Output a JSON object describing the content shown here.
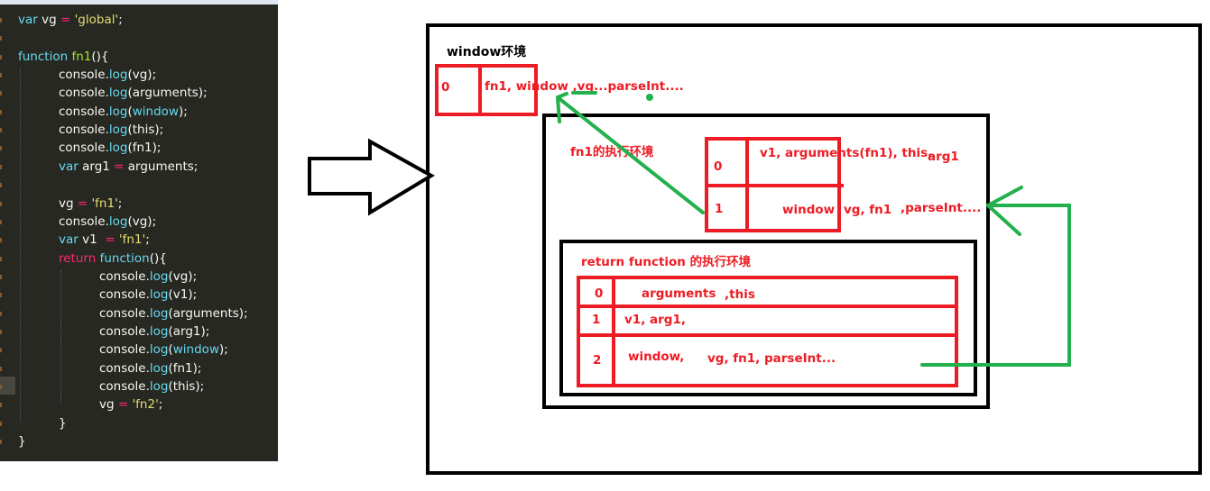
{
  "editor": {
    "lines": [
      {
        "indent": 0,
        "tokens": [
          {
            "t": "var",
            "c": "k"
          },
          {
            "t": " vg ",
            "c": "p"
          },
          {
            "t": "=",
            "c": "o"
          },
          {
            "t": " ",
            "c": "p"
          },
          {
            "t": "'global'",
            "c": "s"
          },
          {
            "t": ";",
            "c": "p"
          }
        ]
      },
      {
        "indent": 0,
        "tokens": []
      },
      {
        "indent": 0,
        "tokens": [
          {
            "t": "function",
            "c": "k"
          },
          {
            "t": " ",
            "c": "p"
          },
          {
            "t": "fn1",
            "c": "f"
          },
          {
            "t": "(){",
            "c": "p"
          }
        ]
      },
      {
        "indent": 1,
        "tokens": [
          {
            "t": "console.",
            "c": "p"
          },
          {
            "t": "log",
            "c": "k"
          },
          {
            "t": "(vg);",
            "c": "p"
          }
        ]
      },
      {
        "indent": 1,
        "tokens": [
          {
            "t": "console.",
            "c": "p"
          },
          {
            "t": "log",
            "c": "k"
          },
          {
            "t": "(arguments);",
            "c": "p"
          }
        ]
      },
      {
        "indent": 1,
        "tokens": [
          {
            "t": "console.",
            "c": "p"
          },
          {
            "t": "log",
            "c": "k"
          },
          {
            "t": "(",
            "c": "p"
          },
          {
            "t": "window",
            "c": "k"
          },
          {
            "t": ");",
            "c": "p"
          }
        ]
      },
      {
        "indent": 1,
        "tokens": [
          {
            "t": "console.",
            "c": "p"
          },
          {
            "t": "log",
            "c": "k"
          },
          {
            "t": "(this);",
            "c": "p"
          }
        ]
      },
      {
        "indent": 1,
        "tokens": [
          {
            "t": "console.",
            "c": "p"
          },
          {
            "t": "log",
            "c": "k"
          },
          {
            "t": "(fn1);",
            "c": "p"
          }
        ]
      },
      {
        "indent": 1,
        "tokens": [
          {
            "t": "var",
            "c": "k"
          },
          {
            "t": " arg1 ",
            "c": "p"
          },
          {
            "t": "=",
            "c": "o"
          },
          {
            "t": " arguments;",
            "c": "p"
          }
        ]
      },
      {
        "indent": 1,
        "tokens": []
      },
      {
        "indent": 1,
        "tokens": [
          {
            "t": "vg ",
            "c": "p"
          },
          {
            "t": "=",
            "c": "o"
          },
          {
            "t": " ",
            "c": "p"
          },
          {
            "t": "'fn1'",
            "c": "s"
          },
          {
            "t": ";",
            "c": "p"
          }
        ]
      },
      {
        "indent": 1,
        "tokens": [
          {
            "t": "console.",
            "c": "p"
          },
          {
            "t": "log",
            "c": "k"
          },
          {
            "t": "(vg);",
            "c": "p"
          }
        ]
      },
      {
        "indent": 1,
        "tokens": [
          {
            "t": "var",
            "c": "k"
          },
          {
            "t": " v1  ",
            "c": "p"
          },
          {
            "t": "=",
            "c": "o"
          },
          {
            "t": " ",
            "c": "p"
          },
          {
            "t": "'fn1'",
            "c": "s"
          },
          {
            "t": ";",
            "c": "p"
          }
        ]
      },
      {
        "indent": 1,
        "tokens": [
          {
            "t": "return",
            "c": "r"
          },
          {
            "t": " ",
            "c": "p"
          },
          {
            "t": "function",
            "c": "k"
          },
          {
            "t": "(){",
            "c": "p"
          }
        ]
      },
      {
        "indent": 2,
        "tokens": [
          {
            "t": "console.",
            "c": "p"
          },
          {
            "t": "log",
            "c": "k"
          },
          {
            "t": "(vg);",
            "c": "p"
          }
        ]
      },
      {
        "indent": 2,
        "tokens": [
          {
            "t": "console.",
            "c": "p"
          },
          {
            "t": "log",
            "c": "k"
          },
          {
            "t": "(v1);",
            "c": "p"
          }
        ]
      },
      {
        "indent": 2,
        "tokens": [
          {
            "t": "console.",
            "c": "p"
          },
          {
            "t": "log",
            "c": "k"
          },
          {
            "t": "(arguments);",
            "c": "p"
          }
        ]
      },
      {
        "indent": 2,
        "tokens": [
          {
            "t": "console.",
            "c": "p"
          },
          {
            "t": "log",
            "c": "k"
          },
          {
            "t": "(arg1);",
            "c": "p"
          }
        ]
      },
      {
        "indent": 2,
        "tokens": [
          {
            "t": "console.",
            "c": "p"
          },
          {
            "t": "log",
            "c": "k"
          },
          {
            "t": "(",
            "c": "p"
          },
          {
            "t": "window",
            "c": "k"
          },
          {
            "t": ");",
            "c": "p"
          }
        ]
      },
      {
        "indent": 2,
        "tokens": [
          {
            "t": "console.",
            "c": "p"
          },
          {
            "t": "log",
            "c": "k"
          },
          {
            "t": "(fn1);",
            "c": "p"
          }
        ]
      },
      {
        "indent": 2,
        "tokens": [
          {
            "t": "console.",
            "c": "p"
          },
          {
            "t": "log",
            "c": "k"
          },
          {
            "t": "(this);",
            "c": "p"
          }
        ]
      },
      {
        "indent": 2,
        "tokens": [
          {
            "t": "vg ",
            "c": "p"
          },
          {
            "t": "=",
            "c": "o"
          },
          {
            "t": " ",
            "c": "p"
          },
          {
            "t": "'fn2'",
            "c": "s"
          },
          {
            "t": ";",
            "c": "p"
          }
        ]
      },
      {
        "indent": 1,
        "tokens": [
          {
            "t": "}",
            "c": "p"
          }
        ]
      },
      {
        "indent": 0,
        "tokens": [
          {
            "t": "}",
            "c": "p"
          }
        ]
      }
    ]
  },
  "diagram": {
    "window_env": {
      "title": "window环境",
      "index": "0",
      "vars": "fn1, window ,vg...parseInt...."
    },
    "fn1_env": {
      "title": "fn1的执行环境",
      "row0": {
        "index": "0",
        "vars": "v1, arguments(fn1), this,",
        "extra": "arg1"
      },
      "row1": {
        "index": "1",
        "vars_a": "window",
        "vars_b": "vg, fn1",
        "vars_c": ",parseInt...."
      }
    },
    "return_env": {
      "title": "return function 的执行环境",
      "row0": {
        "index": "0",
        "vars_a": "arguments",
        "vars_b": ",this"
      },
      "row1": {
        "index": "1",
        "vars": "v1, arg1,"
      },
      "row2": {
        "index": "2",
        "vars_a": "window,",
        "vars_b": "vg, fn1, parseInt..."
      }
    },
    "colors": {
      "scope_box": "#ed1c24",
      "arrow": "#22b14c",
      "frame": "#000000"
    }
  }
}
